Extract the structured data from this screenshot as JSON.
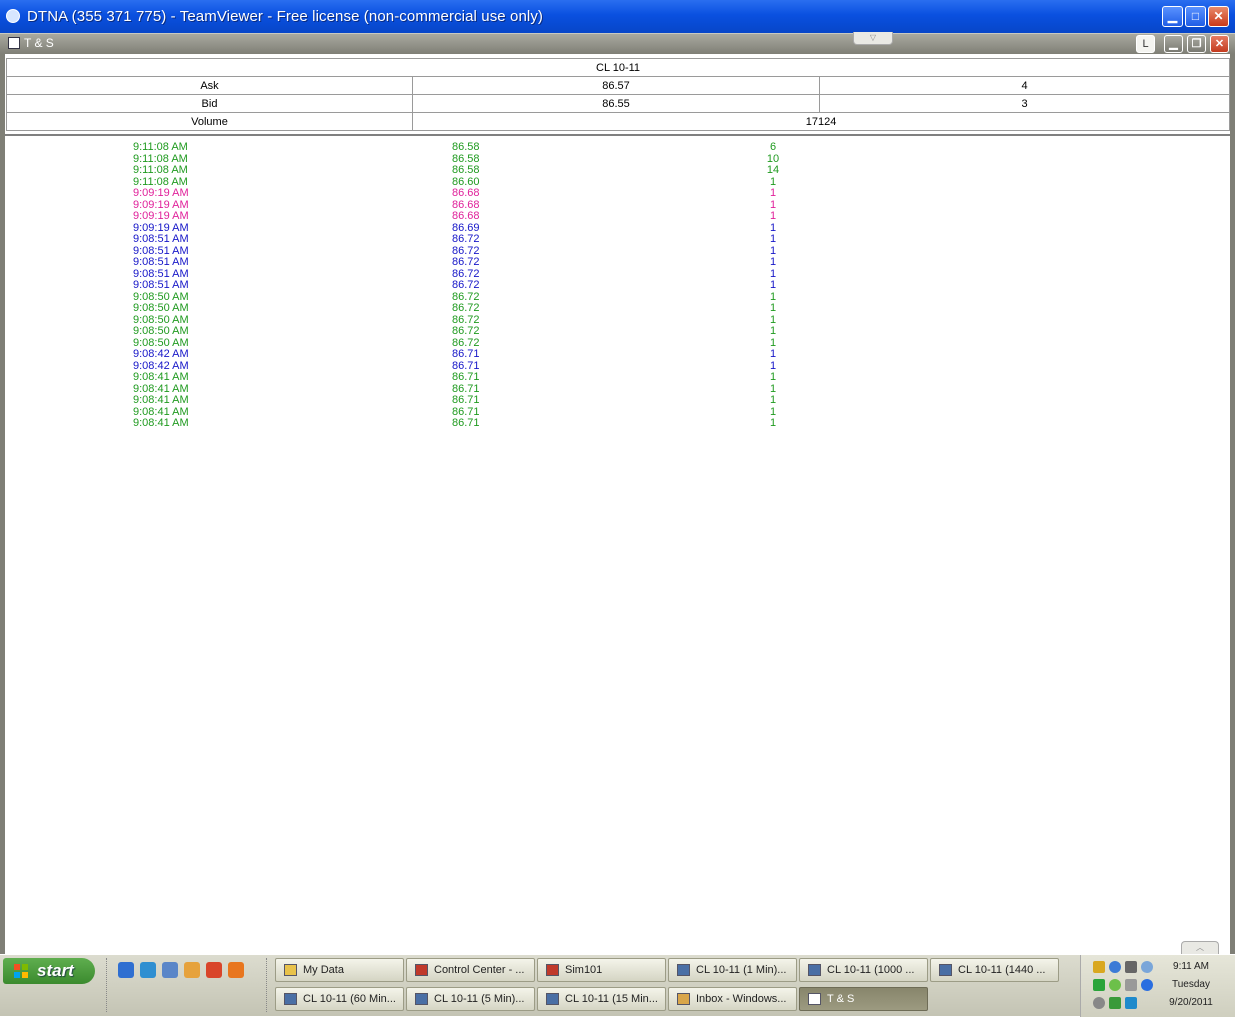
{
  "window": {
    "title": "DTNA (355 371 775) - TeamViewer - Free license (non-commercial use only)"
  },
  "inner_window": {
    "title": "T & S",
    "l_button": "L"
  },
  "quote": {
    "symbol": "CL 10-11",
    "ask": {
      "label": "Ask",
      "price": "86.57",
      "size": "4"
    },
    "bid": {
      "label": "Bid",
      "price": "86.55",
      "size": "3"
    },
    "volume": {
      "label": "Volume",
      "value": "17124"
    }
  },
  "colors": {
    "green": "#1f9a1f",
    "pink": "#e0209a",
    "blue": "#1616c8"
  },
  "trades": [
    {
      "time": "9:11:08 AM",
      "price": "86.58",
      "size": "6",
      "color": "green"
    },
    {
      "time": "9:11:08 AM",
      "price": "86.58",
      "size": "10",
      "color": "green"
    },
    {
      "time": "9:11:08 AM",
      "price": "86.58",
      "size": "14",
      "color": "green"
    },
    {
      "time": "9:11:08 AM",
      "price": "86.60",
      "size": "1",
      "color": "green"
    },
    {
      "time": "9:09:19 AM",
      "price": "86.68",
      "size": "1",
      "color": "pink"
    },
    {
      "time": "9:09:19 AM",
      "price": "86.68",
      "size": "1",
      "color": "pink"
    },
    {
      "time": "9:09:19 AM",
      "price": "86.68",
      "size": "1",
      "color": "pink"
    },
    {
      "time": "9:09:19 AM",
      "price": "86.69",
      "size": "1",
      "color": "blue"
    },
    {
      "time": "9:08:51 AM",
      "price": "86.72",
      "size": "1",
      "color": "blue"
    },
    {
      "time": "9:08:51 AM",
      "price": "86.72",
      "size": "1",
      "color": "blue"
    },
    {
      "time": "9:08:51 AM",
      "price": "86.72",
      "size": "1",
      "color": "blue"
    },
    {
      "time": "9:08:51 AM",
      "price": "86.72",
      "size": "1",
      "color": "blue"
    },
    {
      "time": "9:08:51 AM",
      "price": "86.72",
      "size": "1",
      "color": "blue"
    },
    {
      "time": "9:08:50 AM",
      "price": "86.72",
      "size": "1",
      "color": "green"
    },
    {
      "time": "9:08:50 AM",
      "price": "86.72",
      "size": "1",
      "color": "green"
    },
    {
      "time": "9:08:50 AM",
      "price": "86.72",
      "size": "1",
      "color": "green"
    },
    {
      "time": "9:08:50 AM",
      "price": "86.72",
      "size": "1",
      "color": "green"
    },
    {
      "time": "9:08:50 AM",
      "price": "86.72",
      "size": "1",
      "color": "green"
    },
    {
      "time": "9:08:42 AM",
      "price": "86.71",
      "size": "1",
      "color": "blue"
    },
    {
      "time": "9:08:42 AM",
      "price": "86.71",
      "size": "1",
      "color": "blue"
    },
    {
      "time": "9:08:41 AM",
      "price": "86.71",
      "size": "1",
      "color": "green"
    },
    {
      "time": "9:08:41 AM",
      "price": "86.71",
      "size": "1",
      "color": "green"
    },
    {
      "time": "9:08:41 AM",
      "price": "86.71",
      "size": "1",
      "color": "green"
    },
    {
      "time": "9:08:41 AM",
      "price": "86.71",
      "size": "1",
      "color": "green"
    },
    {
      "time": "9:08:41 AM",
      "price": "86.71",
      "size": "1",
      "color": "green"
    }
  ],
  "taskbar": {
    "start_label": "start",
    "quick_launch": [
      "internet-explorer-icon",
      "media-player-icon",
      "windows-explorer-icon",
      "outlook-icon",
      "paint-icon",
      "firefox-icon"
    ],
    "row1": [
      {
        "label": "My Data",
        "icon": "folder-icon"
      },
      {
        "label": "Control Center - ...",
        "icon": "ninjatrader-icon"
      },
      {
        "label": "Sim101",
        "icon": "ninjatrader-icon"
      },
      {
        "label": "CL 10-11 (1 Min)...",
        "icon": "chart-icon"
      },
      {
        "label": "CL 10-11 (1000 ...",
        "icon": "chart-icon"
      },
      {
        "label": "CL 10-11 (1440 ...",
        "icon": "chart-icon"
      }
    ],
    "row2": [
      {
        "label": "CL 10-11 (60 Min...",
        "icon": "chart-icon"
      },
      {
        "label": "CL 10-11 (5 Min)...",
        "icon": "chart-icon"
      },
      {
        "label": "CL 10-11 (15 Min...",
        "icon": "chart-icon"
      },
      {
        "label": "Inbox - Windows...",
        "icon": "mail-icon"
      },
      {
        "label": "T & S",
        "icon": "grid-icon"
      }
    ]
  },
  "clock": {
    "time": "9:11 AM",
    "day": "Tuesday",
    "date": "9/20/2011"
  }
}
